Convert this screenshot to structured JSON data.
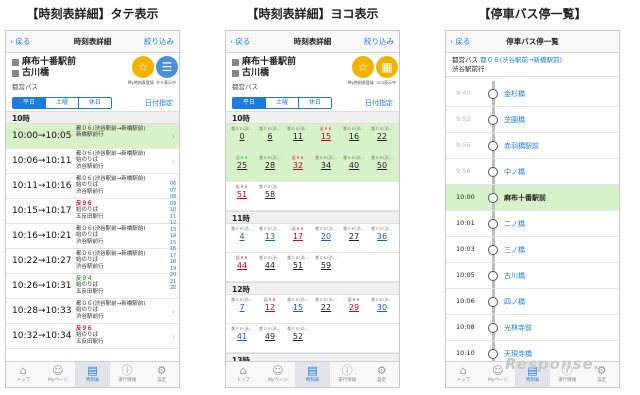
{
  "captions": [
    "【時刻表詳細】タテ表示",
    "【時刻表詳細】ヨコ表示",
    "【停車バス停一覧】"
  ],
  "nav": {
    "back": "戻る",
    "title": "時刻表詳細",
    "filter": "絞り込み",
    "title3": "停車バス停一覧"
  },
  "stops": {
    "a": "麻布十番駅前",
    "b": "古川橋"
  },
  "bus_type": "都営バス",
  "my_label": "My時刻表登録",
  "tate_label": "タテ表示中",
  "yoko_label": "ヨコ表示中",
  "days": [
    "平日",
    "土曜",
    "休日"
  ],
  "date_spec": "日付指定",
  "hour10": "10時",
  "hour11": "11時",
  "hour12": "12時",
  "hour13": "13時",
  "tate_rows": [
    {
      "t": "10:00→10:05",
      "l1": "都０６(渋谷駅前→新橋駅前)",
      "l2": "",
      "l3": "新橋駅前行",
      "c": "n"
    },
    {
      "t": "10:06→10:11",
      "l1": "都０６(渋谷駅前→新橋駅前)",
      "l2": "始のりば",
      "l3": "渋谷駅前行",
      "c": "n"
    },
    {
      "t": "10:11→10:16",
      "l1": "都０６(渋谷駅前→新橋駅前)",
      "l2": "始のりば",
      "l3": "渋谷駅前行",
      "c": "n"
    },
    {
      "t": "10:15→10:17",
      "l1": "反９６",
      "l2": "始のりば",
      "l3": "五反田駅行",
      "c": "r"
    },
    {
      "t": "10:16→10:21",
      "l1": "都０６(渋谷駅前→新橋駅前)",
      "l2": "始のりば",
      "l3": "渋谷駅前行",
      "c": "n"
    },
    {
      "t": "10:22→10:27",
      "l1": "都０６(渋谷駅前→新橋駅前)",
      "l2": "始のりば",
      "l3": "渋谷駅前行",
      "c": "n"
    },
    {
      "t": "10:26→10:31",
      "l1": "反９４",
      "l2": "始のりば",
      "l3": "五反田駅行",
      "c": "g"
    },
    {
      "t": "10:28→10:33",
      "l1": "都０６(渋谷駅前→新橋駅前)",
      "l2": "始のりば",
      "l3": "渋谷駅前行",
      "c": "n"
    },
    {
      "t": "10:32→10:34",
      "l1": "反９６",
      "l2": "始のりば",
      "l3": "五反田駅行",
      "c": "r"
    }
  ],
  "index": [
    "06",
    "07",
    "08",
    "09",
    "10",
    "11",
    "12",
    "13",
    "14",
    "15",
    "16",
    "17",
    "18",
    "19",
    "20",
    "21",
    "22"
  ],
  "yoko": {
    "h10a": [
      {
        "p": "都０６(渋…",
        "m": "0",
        "c": "n"
      },
      {
        "p": "都０６(渋…",
        "m": "6",
        "c": "n"
      },
      {
        "p": "都０６(渋…",
        "m": "11",
        "c": "n"
      },
      {
        "p": "反９６",
        "m": "15",
        "c": "r"
      },
      {
        "p": "都０６(渋…",
        "m": "16",
        "c": "n"
      },
      {
        "p": "都０６(渋…",
        "m": "22",
        "c": "n"
      }
    ],
    "h10b": [
      {
        "p": "反９４",
        "m": "25",
        "c": "g"
      },
      {
        "p": "都０６(渋…",
        "m": "28",
        "c": "n"
      },
      {
        "p": "反９６",
        "m": "32",
        "c": "r"
      },
      {
        "p": "都０６(渋…",
        "m": "34",
        "c": "n"
      },
      {
        "p": "都０６(渋…",
        "m": "40",
        "c": "n"
      },
      {
        "p": "都０６(渋…",
        "m": "50",
        "c": "n"
      }
    ],
    "h10c": [
      {
        "p": "反９６",
        "m": "51",
        "c": "r"
      },
      {
        "p": "都０６(渋…",
        "m": "58",
        "c": "n"
      }
    ],
    "h11a": [
      {
        "p": "都０６(渋…",
        "m": "4",
        "c": "b"
      },
      {
        "p": "都０６(渋…",
        "m": "13",
        "c": "b"
      },
      {
        "p": "反９６",
        "m": "17",
        "c": "r"
      },
      {
        "p": "都０６(渋…",
        "m": "20",
        "c": "b"
      },
      {
        "p": "都０６(渋…",
        "m": "27",
        "c": "n"
      },
      {
        "p": "都０６(渋…",
        "m": "36",
        "c": "b"
      }
    ],
    "h11b": [
      {
        "p": "反９６",
        "m": "44",
        "c": "r"
      },
      {
        "p": "都０６(渋…",
        "m": "44",
        "c": "n"
      },
      {
        "p": "都０６(渋…",
        "m": "51",
        "c": "n"
      },
      {
        "p": "都０６(渋…",
        "m": "59",
        "c": "n"
      }
    ],
    "h12a": [
      {
        "p": "都０６(渋…",
        "m": "7",
        "c": "b"
      },
      {
        "p": "反９６",
        "m": "12",
        "c": "r"
      },
      {
        "p": "都０６(渋…",
        "m": "15",
        "c": "b"
      },
      {
        "p": "都０６(渋…",
        "m": "22",
        "c": "n"
      },
      {
        "p": "反９６",
        "m": "29",
        "c": "r"
      },
      {
        "p": "都０６(渋…",
        "m": "30",
        "c": "b"
      }
    ],
    "h12b": [
      {
        "p": "都０６(渋…",
        "m": "41",
        "c": "b"
      },
      {
        "p": "都０６(渋…",
        "m": "49",
        "c": "n"
      },
      {
        "p": "都０６(渋…",
        "m": "52",
        "c": "n"
      }
    ],
    "h13a": [
      {
        "p": "反９６",
        "m": "0",
        "c": "r"
      },
      {
        "p": "都０６(渋…",
        "m": "5",
        "c": "b"
      },
      {
        "p": "都０６(渋…",
        "m": "13",
        "c": "b"
      },
      {
        "p": "都０６(渋…",
        "m": "21",
        "c": "b"
      },
      {
        "p": "反９６",
        "m": "23",
        "c": "r"
      },
      {
        "p": "反９６",
        "m": "37",
        "c": "r"
      }
    ]
  },
  "route": {
    "bus": "都営バス",
    "line": "都０６(渋谷駅前→新橋駅前)",
    "dest": "渋谷駅前行"
  },
  "stations": [
    {
      "t": "9:45",
      "n": "金杉橋",
      "dk": false
    },
    {
      "t": "9:52",
      "n": "芝園橋",
      "dk": false
    },
    {
      "t": "9:56",
      "n": "赤羽橋駅前",
      "dk": false
    },
    {
      "t": "9:58",
      "n": "中ノ橋",
      "dk": false
    },
    {
      "t": "10:00",
      "n": "麻布十番駅前",
      "dk": true
    },
    {
      "t": "10:01",
      "n": "二ノ橋",
      "dk": true
    },
    {
      "t": "10:03",
      "n": "三ノ橋",
      "dk": true
    },
    {
      "t": "10:05",
      "n": "古川橋",
      "dk": true
    },
    {
      "t": "10:06",
      "n": "四ノ橋",
      "dk": true
    },
    {
      "t": "10:08",
      "n": "光林寺前",
      "dk": true
    },
    {
      "t": "10:10",
      "n": "天現寺橋",
      "dk": true
    }
  ],
  "tabs": [
    "トップ",
    "Myページ",
    "時刻表",
    "運行情報",
    "設定"
  ],
  "watermark": "Response."
}
